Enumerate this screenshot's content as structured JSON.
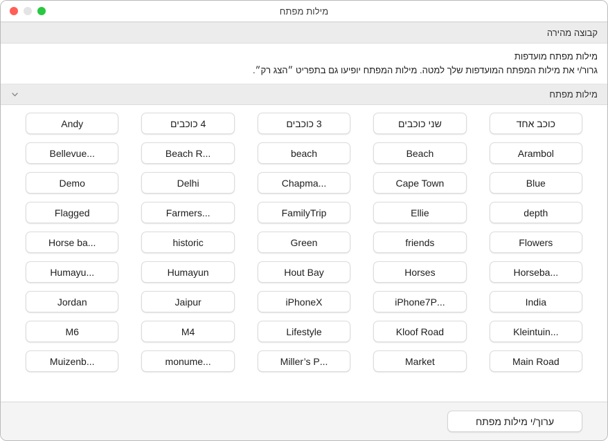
{
  "window": {
    "title": "מילות מפתח",
    "traffic_lights": [
      {
        "name": "zoom",
        "label": "",
        "color": "#28c840"
      },
      {
        "name": "minimize",
        "label": "",
        "color": "#e4e4e4"
      },
      {
        "name": "close",
        "label": "",
        "color": "#ff5f57"
      }
    ]
  },
  "quick_group": {
    "header": "קבוצה מהירה"
  },
  "favorites": {
    "title": "מילות מפתח מועדפות",
    "body": "גרור/י את מילות המפתח המועדפות שלך למטה. מילות המפתח יופיעו גם בתפריט ״הצג רק״."
  },
  "keywords_section": {
    "header": "מילות מפתח",
    "disclosure_icon": "chevron-down-icon",
    "expanded": true
  },
  "keywords": [
    "כוכב אחד",
    "שני כוכבים",
    "3 כוכבים",
    "4 כוכבים",
    "Andy",
    "Arambol",
    "Beach",
    "beach",
    "...Beach R",
    "...Bellevue",
    "Blue",
    "Cape Town",
    "...Chapma",
    "Delhi",
    "Demo",
    "depth",
    "Ellie",
    "FamilyTrip",
    "...Farmers",
    "Flagged",
    "Flowers",
    "friends",
    "Green",
    "historic",
    "...Horse ba",
    "...Horseba",
    "Horses",
    "Hout Bay",
    "Humayun",
    "...Humayu",
    "India",
    "...iPhone7P",
    "iPhoneX",
    "Jaipur",
    "Jordan",
    "...Kleintuin",
    "Kloof Road",
    "Lifestyle",
    "M4",
    "M6",
    "Main Road",
    "Market",
    "...Miller’s P",
    "...monume",
    "...Muizenb"
  ],
  "footer": {
    "edit_button_label": "ערוך/י מילות מפתח"
  },
  "colors": {
    "band_background": "#ececec",
    "footer_background": "#f4f4f4",
    "chip_background": "#ffffff",
    "chip_border": "#dcdcdc",
    "text": "#1d1d1d"
  }
}
